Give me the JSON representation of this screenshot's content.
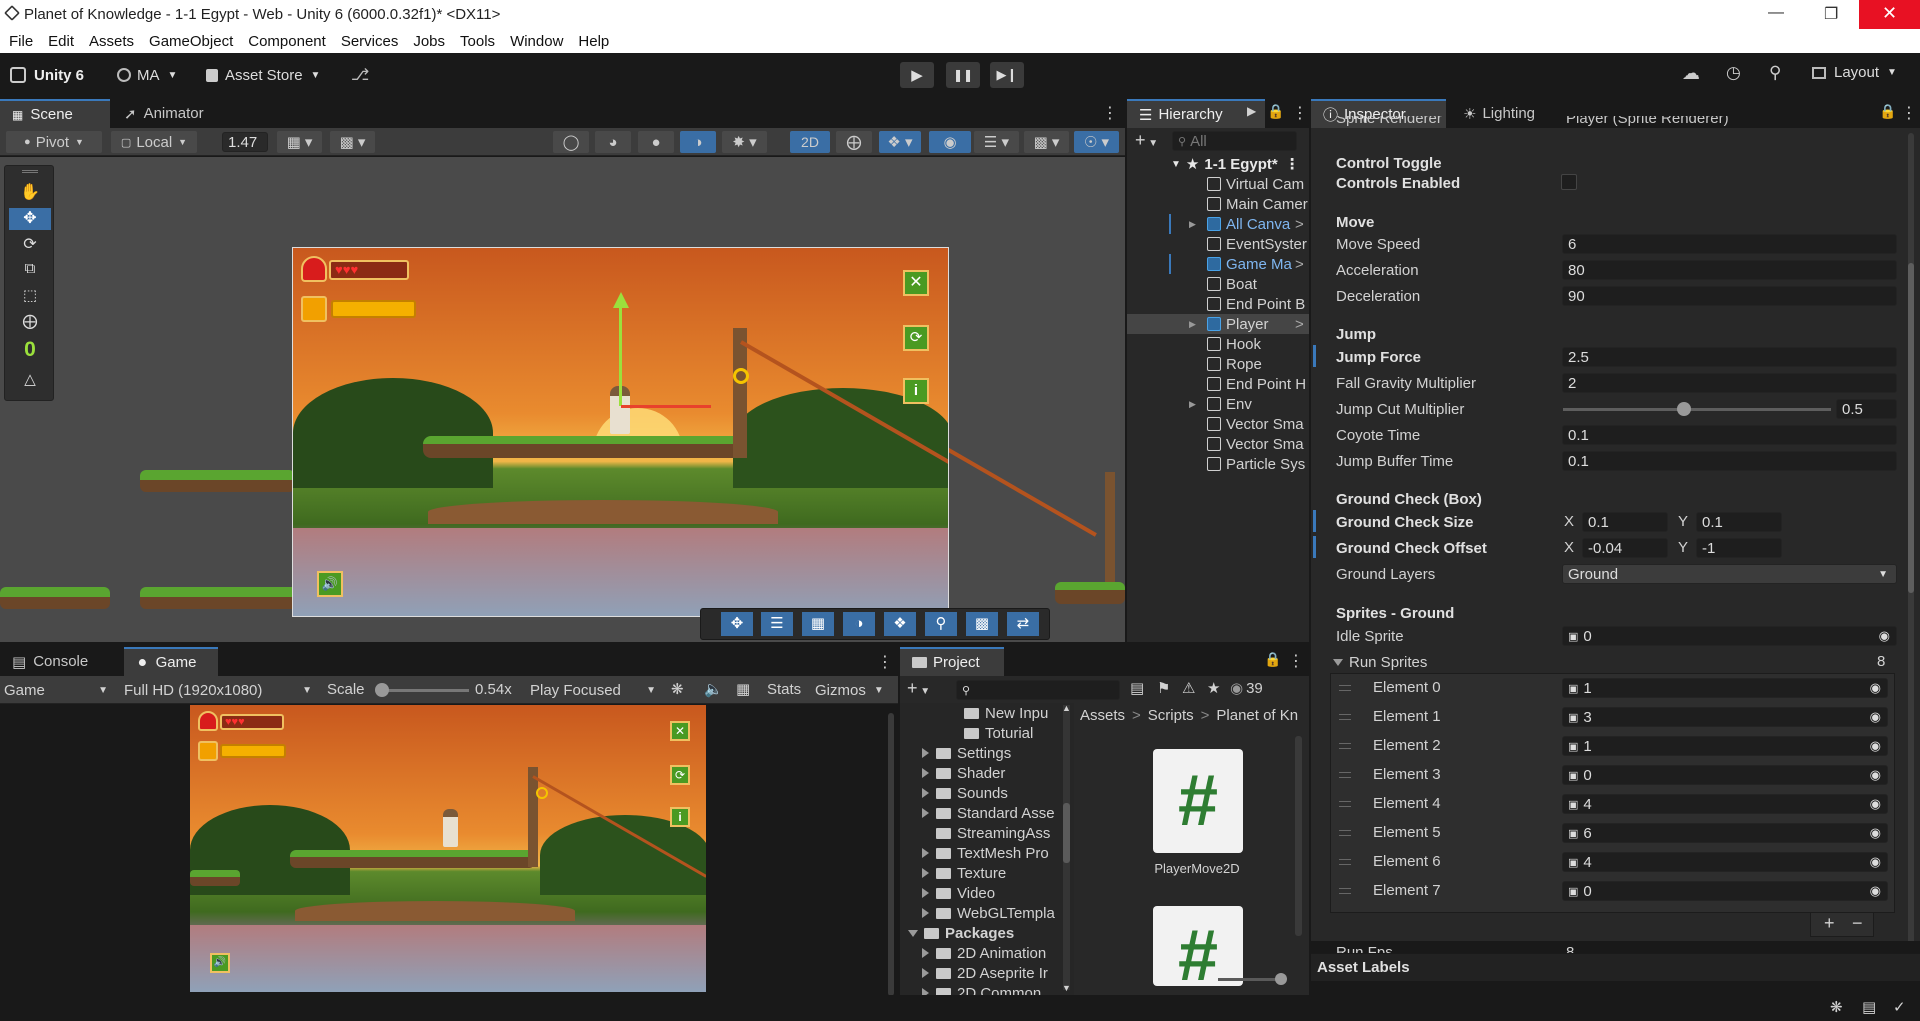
{
  "window": {
    "title": "Planet of Knowledge - 1-1 Egypt - Web - Unity 6 (6000.0.32f1)* <DX11>"
  },
  "menu": [
    "File",
    "Edit",
    "Assets",
    "GameObject",
    "Component",
    "Services",
    "Jobs",
    "Tools",
    "Window",
    "Help"
  ],
  "toolbar": {
    "unity_label": "Unity 6",
    "account": "MA",
    "asset_store": "Asset Store",
    "layout": "Layout"
  },
  "scene": {
    "tabs": [
      "Scene",
      "Animator"
    ],
    "pivot": "Pivot",
    "local": "Local",
    "zoom": "1.47",
    "mode_2d": "2D",
    "tool_counter": "0"
  },
  "hierarchy": {
    "tab": "Hierarchy",
    "search_placeholder": "All",
    "root": "1-1 Egypt*",
    "items": [
      {
        "label": "Virtual Cam"
      },
      {
        "label": "Main Camer"
      },
      {
        "label": "All Canva"
      },
      {
        "label": "EventSyster"
      },
      {
        "label": "Game Ma"
      },
      {
        "label": "Boat"
      },
      {
        "label": "End Point B"
      },
      {
        "label": "Player"
      },
      {
        "label": "Hook"
      },
      {
        "label": "Rope"
      },
      {
        "label": "End Point H"
      },
      {
        "label": "Env"
      },
      {
        "label": "Vector Sma"
      },
      {
        "label": "Vector Sma"
      },
      {
        "label": "Particle Sys"
      }
    ]
  },
  "inspector": {
    "tabs": [
      "Inspector",
      "Lighting"
    ],
    "cut_top_label": "Sprite Renderer",
    "cut_top_value": "Player (Sprite Renderer)",
    "control_toggle": "Control Toggle",
    "controls_enabled": "Controls Enabled",
    "move": "Move",
    "move_speed": {
      "label": "Move Speed",
      "value": "6"
    },
    "acceleration": {
      "label": "Acceleration",
      "value": "80"
    },
    "deceleration": {
      "label": "Deceleration",
      "value": "90"
    },
    "jump": "Jump",
    "jump_force": {
      "label": "Jump Force",
      "value": "2.5"
    },
    "fall_gravity": {
      "label": "Fall Gravity Multiplier",
      "value": "2"
    },
    "jump_cut": {
      "label": "Jump Cut Multiplier",
      "value": "0.5"
    },
    "coyote": {
      "label": "Coyote Time",
      "value": "0.1"
    },
    "jump_buffer": {
      "label": "Jump Buffer Time",
      "value": "0.1"
    },
    "ground_check": "Ground Check (Box)",
    "gc_size": {
      "label": "Ground Check Size",
      "x": "0.1",
      "y": "0.1"
    },
    "gc_offset": {
      "label": "Ground Check Offset",
      "x": "-0.04",
      "y": "-1"
    },
    "ground_layers": {
      "label": "Ground Layers",
      "value": "Ground"
    },
    "sprites_ground": "Sprites - Ground",
    "idle_sprite": {
      "label": "Idle Sprite",
      "value": "0"
    },
    "run_sprites": {
      "label": "Run Sprites",
      "count": "8"
    },
    "elements": [
      {
        "label": "Element 0",
        "value": "1"
      },
      {
        "label": "Element 1",
        "value": "3"
      },
      {
        "label": "Element 2",
        "value": "1"
      },
      {
        "label": "Element 3",
        "value": "0"
      },
      {
        "label": "Element 4",
        "value": "4"
      },
      {
        "label": "Element 5",
        "value": "6"
      },
      {
        "label": "Element 6",
        "value": "4"
      },
      {
        "label": "Element 7",
        "value": "0"
      }
    ],
    "cut_bottom_label": "Run Fps",
    "cut_bottom_value": "8",
    "asset_labels": "Asset Labels",
    "x_label": "X",
    "y_label": "Y"
  },
  "game": {
    "tabs": [
      "Console",
      "Game"
    ],
    "display": "Game",
    "resolution": "Full HD (1920x1080)",
    "scale_label": "Scale",
    "scale_value": "0.54x",
    "play_mode": "Play Focused",
    "stats": "Stats",
    "gizmos": "Gizmos"
  },
  "project": {
    "tab": "Project",
    "hidden_count": "39",
    "breadcrumb": [
      "Assets",
      "Scripts",
      "Planet of Kn"
    ],
    "tree": [
      {
        "label": "New Inpu",
        "indent": 3,
        "arrow": false
      },
      {
        "label": "Toturial",
        "indent": 3,
        "arrow": false
      },
      {
        "label": "Settings",
        "indent": 1,
        "arrow": true
      },
      {
        "label": "Shader",
        "indent": 1,
        "arrow": true
      },
      {
        "label": "Sounds",
        "indent": 1,
        "arrow": true
      },
      {
        "label": "Standard Asse",
        "indent": 1,
        "arrow": true
      },
      {
        "label": "StreamingAss",
        "indent": 1,
        "arrow": false
      },
      {
        "label": "TextMesh Pro",
        "indent": 1,
        "arrow": true
      },
      {
        "label": "Texture",
        "indent": 1,
        "arrow": true
      },
      {
        "label": "Video",
        "indent": 1,
        "arrow": true
      },
      {
        "label": "WebGLTempla",
        "indent": 1,
        "arrow": true
      },
      {
        "label": "Packages",
        "indent": 0,
        "arrow": true
      },
      {
        "label": "2D Animation",
        "indent": 1,
        "arrow": true
      },
      {
        "label": "2D Aseprite Ir",
        "indent": 1,
        "arrow": true
      },
      {
        "label": "2D Common",
        "indent": 1,
        "arrow": true
      }
    ],
    "asset_name": "PlayerMove2D",
    "asset_glyph": "#"
  },
  "colors": {
    "accent": "#3a79bb",
    "panel": "#282828",
    "dark": "#191919",
    "sky": "#e98b2f"
  }
}
